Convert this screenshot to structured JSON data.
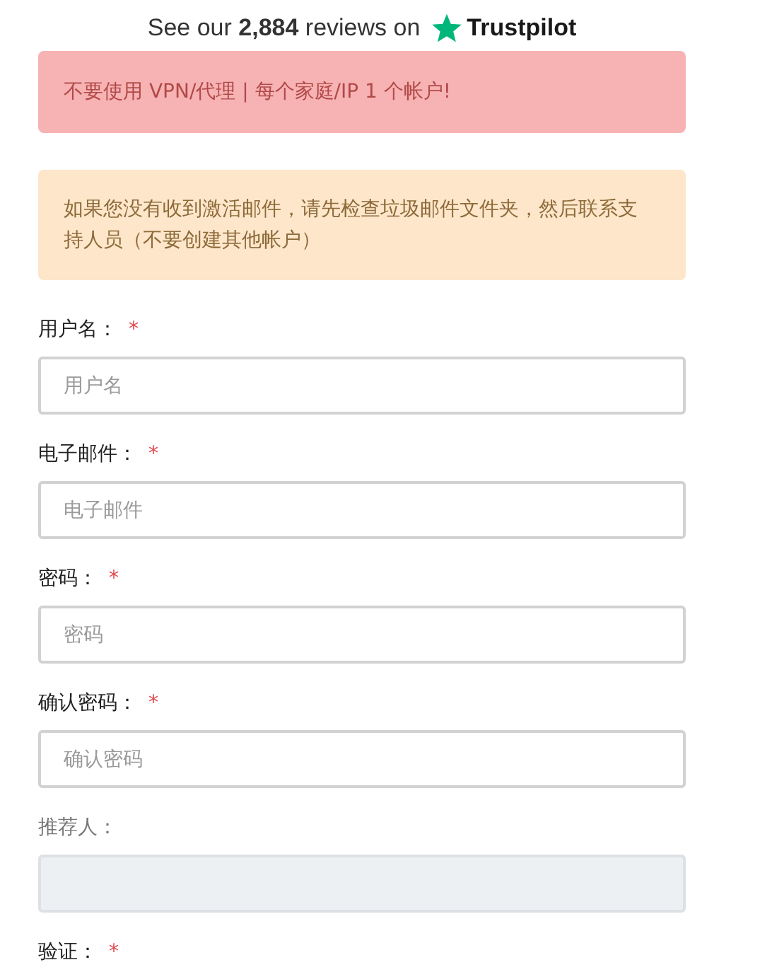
{
  "trustpilot": {
    "text": "See our **2,884** reviews on",
    "brand": "Trustpilot"
  },
  "alerts": [
    {
      "kind": "danger",
      "text": "不要使用 VPN/代理 | 每个家庭/IP 1 个帐户!"
    },
    {
      "kind": "warning",
      "text": "如果您没有收到激活邮件，请先检查垃圾邮件文件夹，然后联系支持人员（不要创建其他帐户）"
    }
  ],
  "fields": [
    {
      "kind": "input",
      "label": "用户名：",
      "required_mark": "*",
      "placeholder": "用户名",
      "disabled": false
    },
    {
      "kind": "input",
      "label": "电子邮件：",
      "required_mark": "*",
      "placeholder": "电子邮件",
      "disabled": false
    },
    {
      "kind": "input",
      "label": "密码：",
      "required_mark": "*",
      "placeholder": "密码",
      "disabled": false
    },
    {
      "kind": "input",
      "label": "确认密码：",
      "required_mark": "*",
      "placeholder": "确认密码",
      "disabled": false
    },
    {
      "kind": "input",
      "label": "推荐人：",
      "disabled": true
    },
    {
      "kind": "label",
      "label": "验证：",
      "required_mark": "*"
    }
  ]
}
